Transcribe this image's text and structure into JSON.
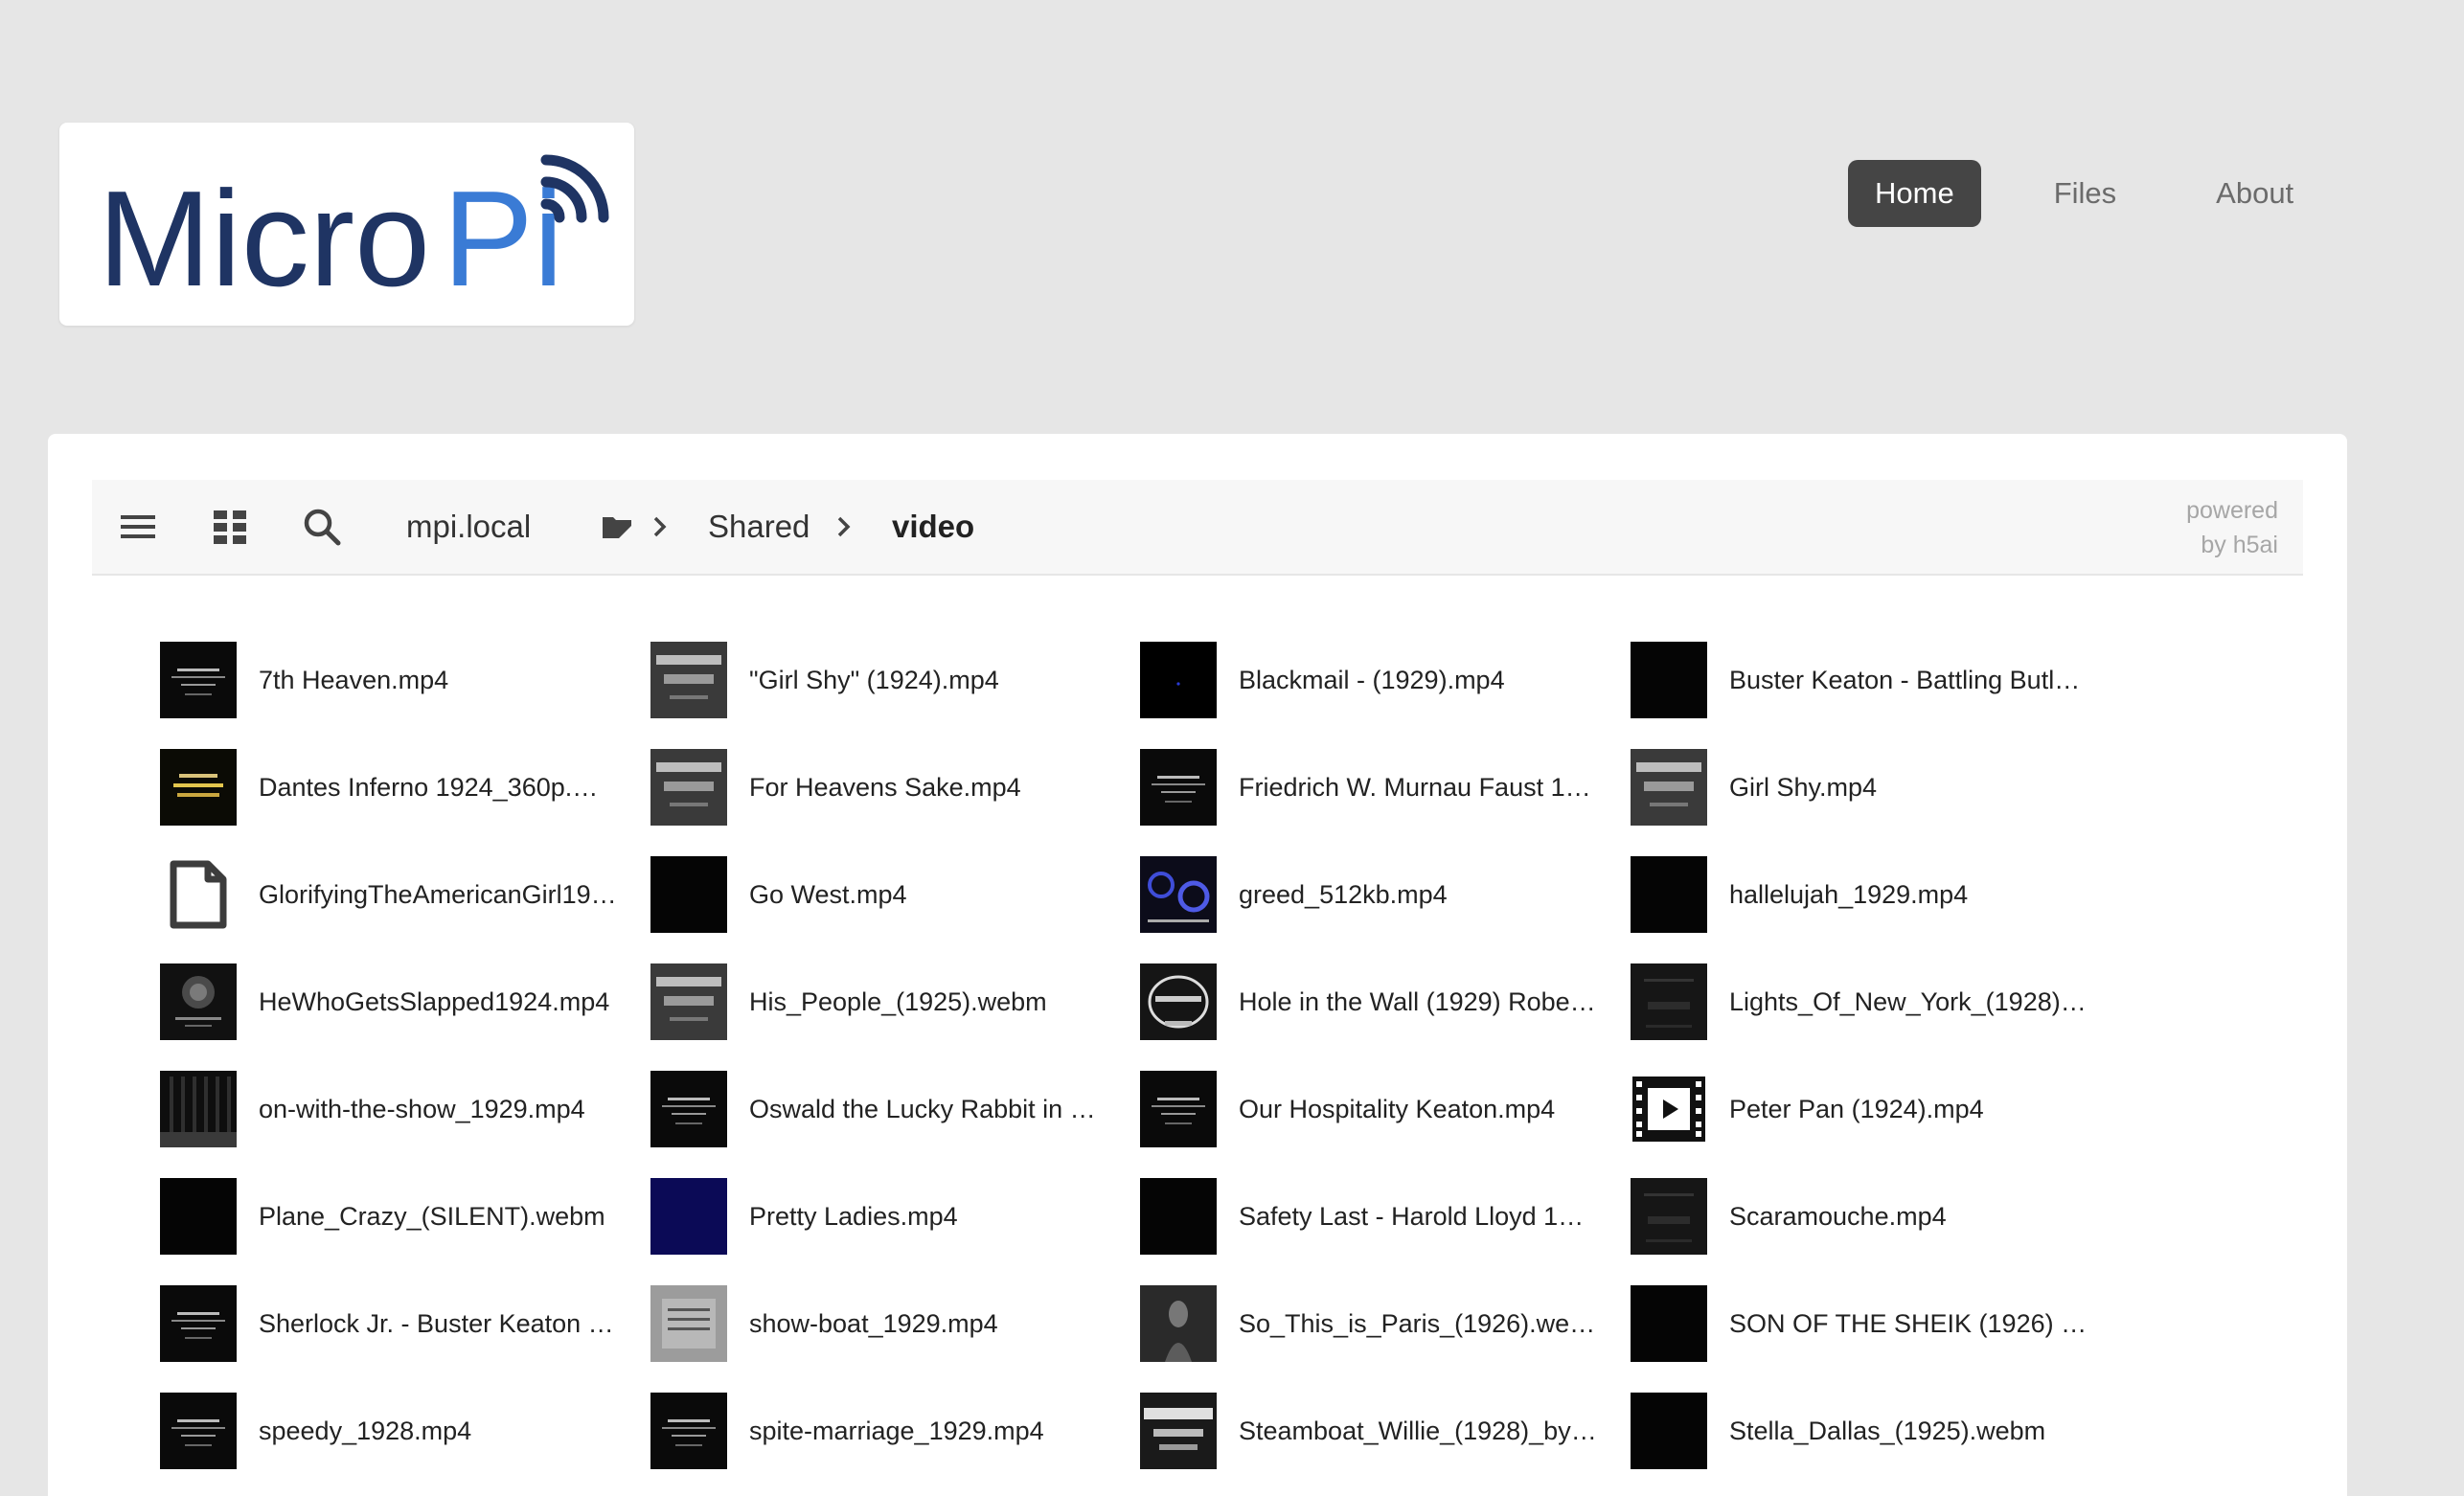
{
  "logo": {
    "text_dark": "Micro",
    "text_accent": "Pi",
    "dark_color": "#1f3463",
    "accent_color": "#3a7bd5"
  },
  "nav": [
    {
      "label": "Home",
      "active": true
    },
    {
      "label": "Files",
      "active": false
    },
    {
      "label": "About",
      "active": false
    }
  ],
  "toolbar": {
    "icons": [
      "menu-icon",
      "grid-view-icon",
      "search-icon"
    ],
    "breadcrumb": [
      {
        "label": "mpi.local",
        "icon": "folder-icon"
      },
      {
        "label": "Shared"
      },
      {
        "label": "video",
        "current": true
      }
    ],
    "powered_line1": "powered",
    "powered_line2": "by h5ai"
  },
  "files": [
    [
      "7th Heaven.mp4",
      "\"Girl Shy\" (1924).mp4",
      "Blackmail - (1929).mp4",
      "Buster Keaton - Battling Butl…"
    ],
    [
      "Dantes Inferno 1924_360p.…",
      "For Heavens Sake.mp4",
      "Friedrich W. Murnau Faust 1…",
      "Girl Shy.mp4"
    ],
    [
      "GlorifyingTheAmericanGirl19…",
      "Go West.mp4",
      "greed_512kb.mp4",
      "hallelujah_1929.mp4"
    ],
    [
      "HeWhoGetsSlapped1924.mp4",
      "His_People_(1925).webm",
      "Hole in the Wall (1929) Robe…",
      "Lights_Of_New_York_(1928)…"
    ],
    [
      "on-with-the-show_1929.mp4",
      "Oswald the Lucky Rabbit in …",
      "Our Hospitality Keaton.mp4",
      "Peter Pan (1924).mp4"
    ],
    [
      "Plane_Crazy_(SILENT).webm",
      "Pretty Ladies.mp4",
      "Safety Last - Harold Lloyd 1…",
      "Scaramouche.mp4"
    ],
    [
      "Sherlock Jr. - Buster Keaton …",
      "show-boat_1929.mp4",
      "So_This_is_Paris_(1926).we…",
      "SON OF THE SHEIK (1926) …"
    ],
    [
      "speedy_1928.mp4",
      "spite-marriage_1929.mp4",
      "Steamboat_Willie_(1928)_by…",
      "Stella_Dallas_(1925).webm"
    ]
  ],
  "thumb_styles": [
    [
      "title-card",
      "title-card-gray",
      "black-blue",
      "black"
    ],
    [
      "title-card-yellow",
      "title-card-gray",
      "title-card",
      "title-card-gray"
    ],
    [
      "file-icon",
      "black",
      "blue-logo",
      "black"
    ],
    [
      "mgm-dark",
      "title-card-gray",
      "paramount",
      "dark-gray"
    ],
    [
      "stage-dark",
      "title-card",
      "title-card",
      "video-icon"
    ],
    [
      "black",
      "navy",
      "black",
      "dark-gray"
    ],
    [
      "title-card",
      "light-gray",
      "dark-figure",
      "black"
    ],
    [
      "title-card",
      "title-card",
      "title-card-light",
      "black"
    ]
  ]
}
